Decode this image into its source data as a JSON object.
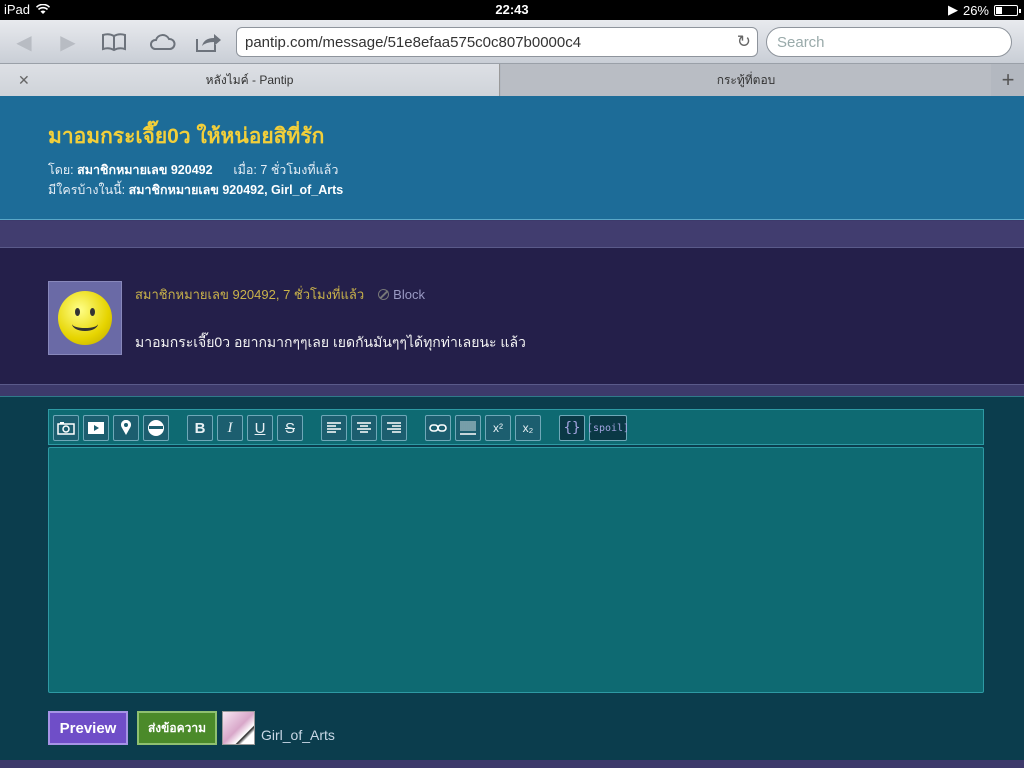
{
  "status_bar": {
    "device": "iPad",
    "time": "22:43",
    "battery": "26%"
  },
  "browser": {
    "url": "pantip.com/message/51e8efaa575c0c807b0000c4",
    "search_placeholder": "Search",
    "tabs": [
      {
        "label": "หลังไมค์ - Pantip",
        "active": true
      },
      {
        "label": "กระทู้ที่ตอบ",
        "active": false
      }
    ]
  },
  "topic": {
    "title": "มาอมกระเจี๊ย0ว ให้หน่อยสิที่รัก",
    "by_label": "โดย:",
    "author": "สมาชิกหมายเลข 920492",
    "when_label": "เมื่อ:",
    "when": "7 ชั่วโมงที่แล้ว",
    "participants_label": "มีใครบ้างในนี้:",
    "participants": "สมาชิกหมายเลข 920492, Girl_of_Arts"
  },
  "reply": {
    "meta": "สมาชิกหมายเลข 920492, 7 ชั่วโมงที่แล้ว",
    "block_label": "Block",
    "text": "มาอมกระเจี๊ย0ว อยากมากๆๆเลย เยดกันมันๆๆได้ทุกท่าเลยนะ แล้ว"
  },
  "editor": {
    "toolbar": {
      "bold": "B",
      "italic": "I",
      "underline": "U",
      "strike": "S",
      "sup": "x²",
      "sub": "x₂",
      "code": "{}",
      "spoil": "[spoil]"
    },
    "preview_label": "Preview",
    "send_label": "ส่งข้อความ",
    "current_user": "Girl_of_Arts"
  },
  "colors": {
    "topic_bg": "#1d6c98",
    "title": "#f2cf3a",
    "reply_bg": "#241f4a",
    "editor_bg": "#0b3d4d",
    "preview_btn": "#6f4ec8",
    "send_btn": "#4b8a2a"
  }
}
